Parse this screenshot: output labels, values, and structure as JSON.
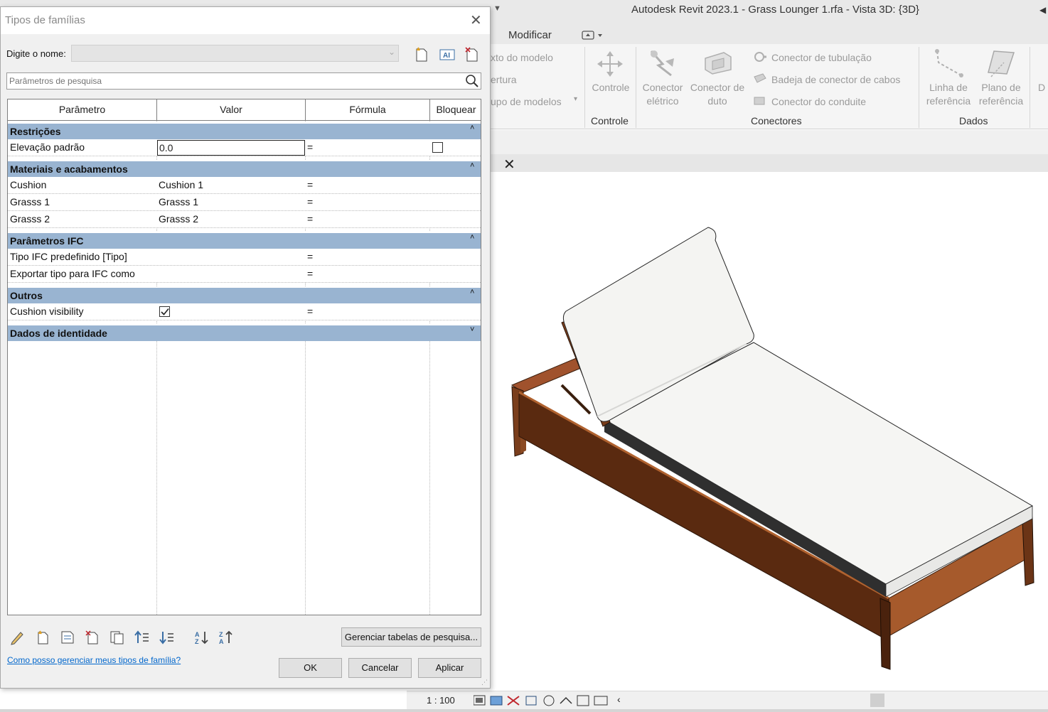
{
  "revit": {
    "title": "Autodesk Revit 2023.1 - Grass Lounger 1.rfa - Vista 3D: {3D}",
    "tabs": {
      "modificar": "Modificar"
    },
    "ribbon": {
      "model_group": {
        "line1": "xto do  modelo",
        "line2": "ertura",
        "line3": "upo de  modelos"
      },
      "controle_button": "Controle",
      "controle_panel": "Controle",
      "conector_eletrico": [
        "Conector",
        "elétrico"
      ],
      "conector_duto": [
        "Conector de",
        "duto"
      ],
      "conector_tubulacao": "Conector de  tubulação",
      "badeja_conector": "Badeja de conector  de cabos",
      "conector_conduite": "Conector do  conduite",
      "conectores_panel": "Conectores",
      "linha_ref": [
        "Linha de",
        "referência"
      ],
      "plano_ref": [
        "Plano de",
        "referência"
      ],
      "dados_panel": "Dados",
      "cut_letter": "D"
    },
    "status": {
      "scale": "1 : 100"
    },
    "colors": {
      "ribbon_bg": "#f5f5f5",
      "group_header": "#99b4d1"
    }
  },
  "dialog": {
    "title": "Tipos de famílias",
    "name_label": "Digite o nome:",
    "search_placeholder": "Parâmetros de pesquisa",
    "columns": [
      "Parâmetro",
      "Valor",
      "Fórmula",
      "Bloquear"
    ],
    "groups": {
      "restricoes": "Restrições",
      "materiais": "Materiais e acabamentos",
      "ifc": "Parâmetros IFC",
      "outros": "Outros",
      "identidade": "Dados de identidade"
    },
    "rows": {
      "elevacao": {
        "param": "Elevação padrão",
        "value": "0.0",
        "formula": "="
      },
      "cushion": {
        "param": "Cushion",
        "value": "Cushion 1",
        "formula": "="
      },
      "grasss1": {
        "param": "Grasss 1",
        "value": "Grasss 1",
        "formula": "="
      },
      "grasss2": {
        "param": "Grasss 2",
        "value": "Grasss 2",
        "formula": "="
      },
      "tipo_ifc": {
        "param": "Tipo IFC predefinido [Tipo]",
        "value": "",
        "formula": "="
      },
      "exportar_ifc": {
        "param": "Exportar tipo para IFC como",
        "value": "",
        "formula": "="
      },
      "cushion_vis": {
        "param": "Cushion visibility",
        "checked": true,
        "formula": "="
      }
    },
    "manage_button": "Gerenciar tabelas de pesquisa...",
    "help_link": "Como posso gerenciar meus tipos de família?",
    "ok": "OK",
    "cancel": "Cancelar",
    "apply": "Aplicar"
  }
}
